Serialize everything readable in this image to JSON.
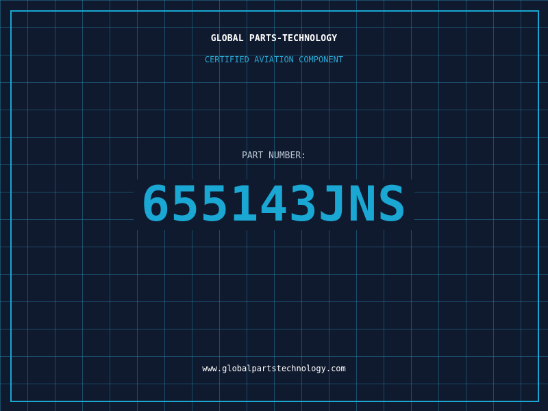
{
  "header": {
    "company_name": "GLOBAL PARTS-TECHNOLOGY",
    "subtitle": "CERTIFIED AVIATION COMPONENT"
  },
  "part": {
    "label": "PART NUMBER:",
    "number": "65514 3JNS"
  },
  "footer": {
    "website": "www.globalpartstechnology.com"
  },
  "colors": {
    "background": "#101a2e",
    "grid": "#288cb4",
    "accent": "#1aa7d3",
    "label": "#b9c4d2",
    "white": "#ffffff"
  }
}
